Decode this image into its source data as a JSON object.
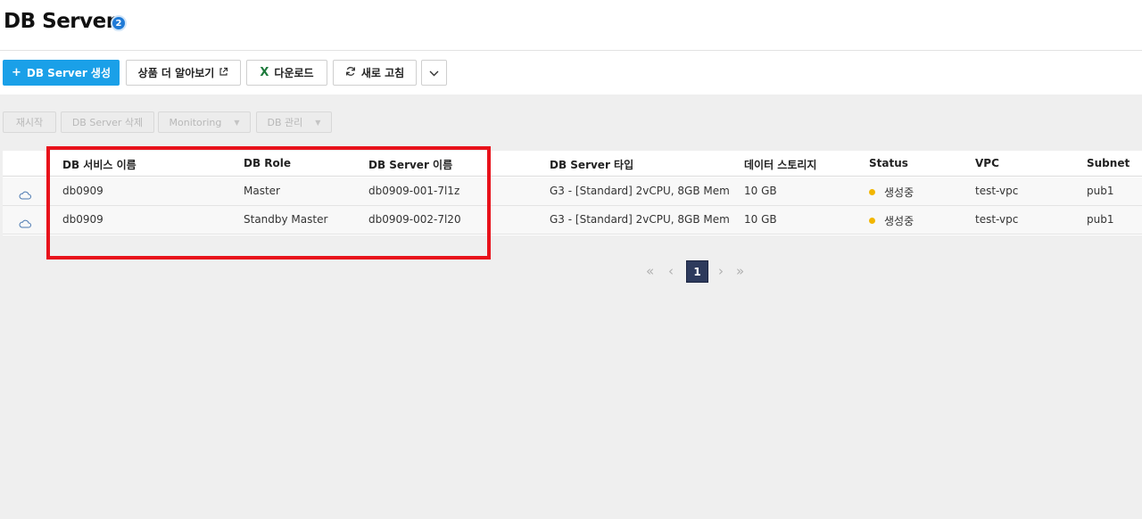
{
  "page": {
    "title": "DB Server",
    "badge_count": "2"
  },
  "toolbar": {
    "create_label": "DB Server 생성",
    "learn_more_label": "상품 더 알아보기",
    "download_label": "다운로드",
    "refresh_label": "새로 고침",
    "excel_icon_glyph": "X"
  },
  "actions": {
    "restart_label": "재시작",
    "delete_label": "DB Server 삭제",
    "monitoring_label": "Monitoring",
    "db_manage_label": "DB 관리"
  },
  "table": {
    "columns": [
      "DB 서비스 이름",
      "DB Role",
      "DB Server 이름",
      "DB Server 타입",
      "데이터 스토리지",
      "Status",
      "VPC",
      "Subnet"
    ],
    "rows": [
      {
        "service": "db0909",
        "role": "Master",
        "server": "db0909-001-7l1z",
        "type": "G3 - [Standard] 2vCPU, 8GB Mem",
        "storage": "10 GB",
        "status": "생성중",
        "vpc": "test-vpc",
        "subnet": "pub1"
      },
      {
        "service": "db0909",
        "role": "Standby Master",
        "server": "db0909-002-7l20",
        "type": "G3 - [Standard] 2vCPU, 8GB Mem",
        "storage": "10 GB",
        "status": "생성중",
        "vpc": "test-vpc",
        "subnet": "pub1"
      }
    ]
  },
  "pagination": {
    "current_page": "1"
  },
  "colors": {
    "primary": "#1aa0e8",
    "badge": "#1f7ad6",
    "status_dot": "#f2b600",
    "highlight": "#e8121b",
    "active_page": "#2d3a5c"
  }
}
